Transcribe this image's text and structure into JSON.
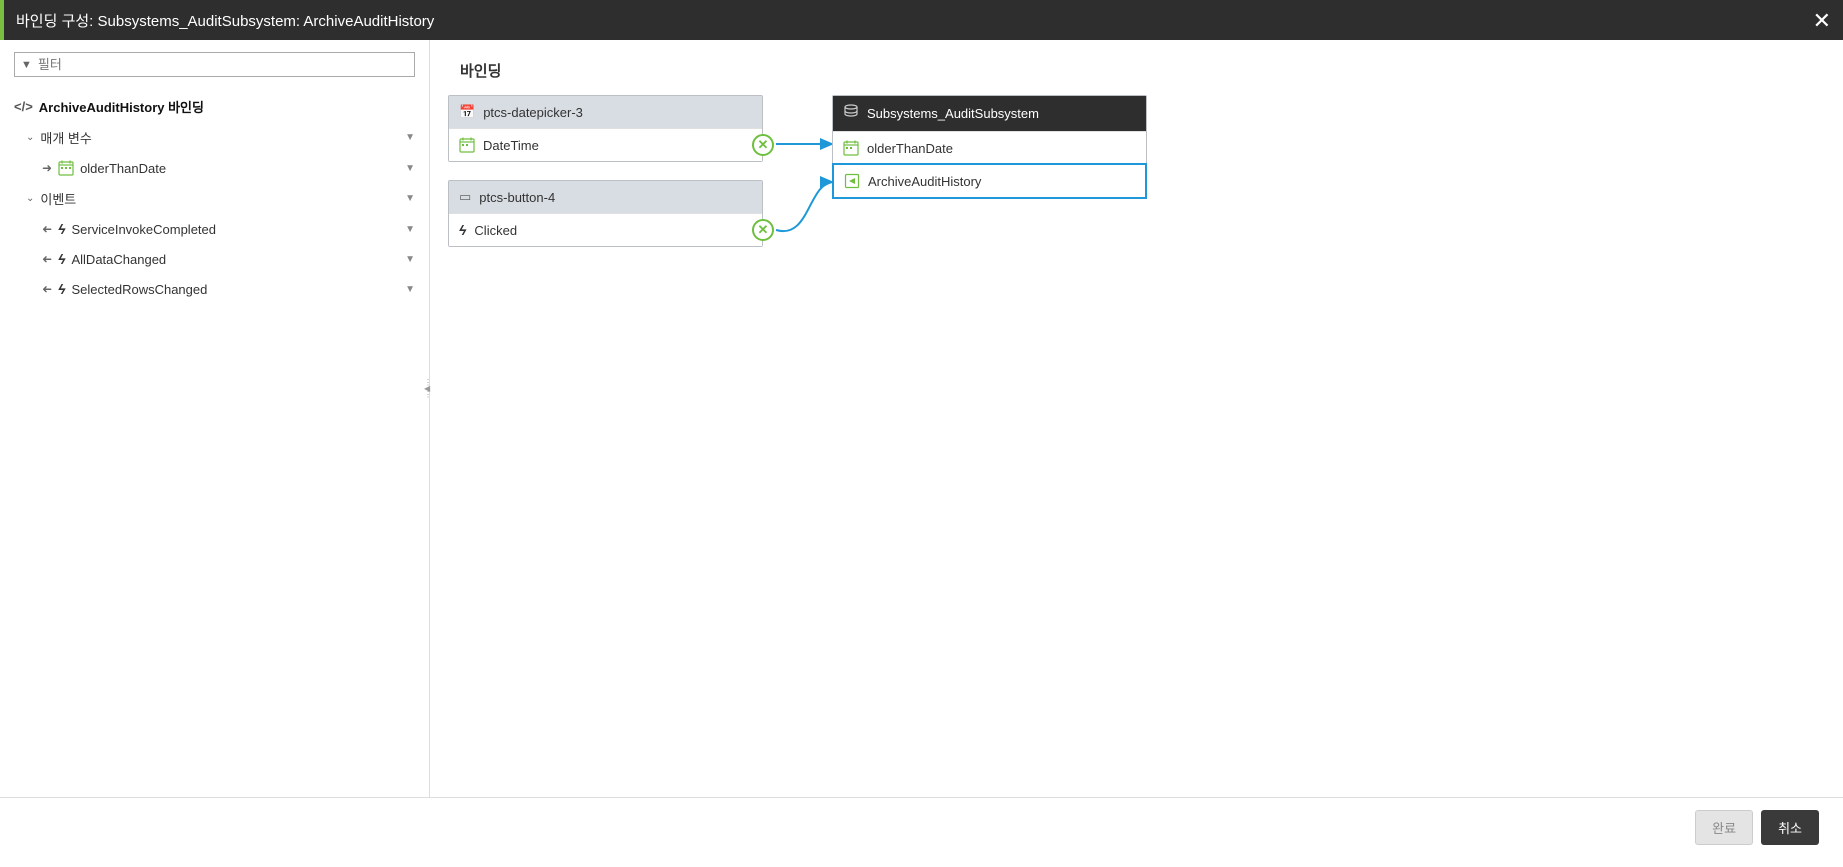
{
  "header": {
    "title": "바인딩 구성: Subsystems_AuditSubsystem: ArchiveAuditHistory"
  },
  "sidebar": {
    "filter_placeholder": "필터",
    "root_label": "ArchiveAuditHistory 바인딩",
    "sections": {
      "params": {
        "label": "매개 변수",
        "items": [
          {
            "label": "olderThanDate"
          }
        ]
      },
      "events": {
        "label": "이벤트",
        "items": [
          {
            "label": "ServiceInvokeCompleted"
          },
          {
            "label": "AllDataChanged"
          },
          {
            "label": "SelectedRowsChanged"
          }
        ]
      }
    }
  },
  "canvas": {
    "title": "바인딩",
    "blocks": {
      "datepicker": {
        "title": "ptcs-datepicker-3",
        "rows": [
          {
            "label": "DateTime"
          }
        ]
      },
      "button": {
        "title": "ptcs-button-4",
        "rows": [
          {
            "label": "Clicked"
          }
        ]
      },
      "subsystem": {
        "title": "Subsystems_AuditSubsystem",
        "rows": [
          {
            "label": "olderThanDate"
          },
          {
            "label": "ArchiveAuditHistory"
          }
        ]
      }
    }
  },
  "footer": {
    "done": "완료",
    "cancel": "취소"
  }
}
